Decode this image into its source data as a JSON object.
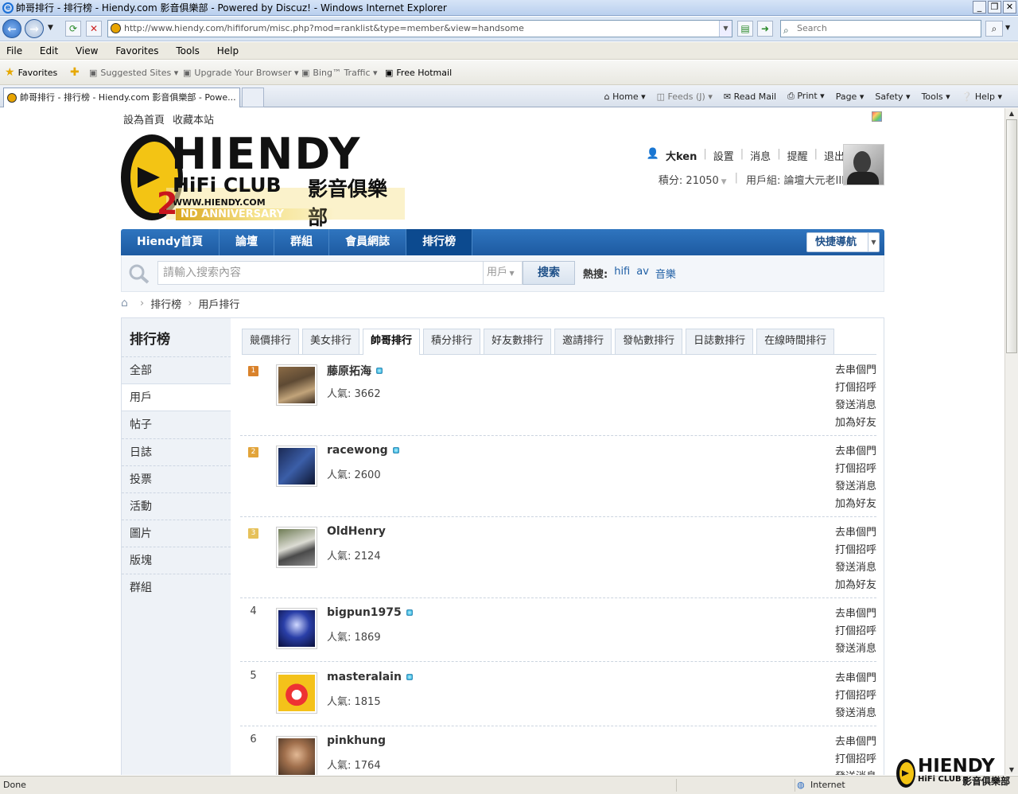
{
  "window": {
    "title": "帥哥排行 - 排行榜 - Hiendy.com 影音俱樂部 - Powered by Discuz! - Windows Internet Explorer"
  },
  "browser": {
    "url": "http://www.hiendy.com/hififorum/misc.php?mod=ranklist&type=member&view=handsome",
    "search_placeholder": "Search",
    "menu": [
      "File",
      "Edit",
      "View",
      "Favorites",
      "Tools",
      "Help"
    ],
    "favorites_label": "Favorites",
    "fav_items": [
      "Suggested Sites ▾",
      "Upgrade Your Browser ▾",
      "Bing™ Traffic ▾",
      "Free Hotmail"
    ],
    "tab_title": "帥哥排行 - 排行榜 - Hiendy.com 影音俱樂部 - Powe...",
    "commands": [
      "Home ▾",
      "Feeds (J) ▾",
      "Read Mail",
      "Print ▾",
      "Page ▾",
      "Safety ▾",
      "Tools ▾",
      "Help ▾"
    ],
    "status_left": "Done",
    "status_zone": "Internet"
  },
  "site": {
    "toplinks": [
      "設為首頁",
      "收藏本站"
    ],
    "logo": {
      "brand": "HIENDY",
      "sub1": "HiFi CLUB",
      "sub2": "影音俱樂部",
      "url": "WWW.HIENDY.COM",
      "anniv_num": "2",
      "anniv_text": "ND ANNIVERSARY"
    },
    "user": {
      "name": "大ken",
      "links": [
        "設置",
        "消息",
        "提醒",
        "退出"
      ],
      "points_label": "積分: 21050",
      "group_label": "用戶組: 論壇大元老III"
    },
    "nav": [
      "Hiendy首頁",
      "論壇",
      "群組",
      "會員網誌",
      "排行榜"
    ],
    "quicknav": "快捷導航",
    "search": {
      "placeholder": "請輸入搜索內容",
      "type": "用戶",
      "button": "搜索",
      "hot_label": "熱搜:",
      "hot": [
        "hifi",
        "av",
        "音樂"
      ]
    },
    "breadcrumb": [
      "排行榜",
      "用戶排行"
    ]
  },
  "sidebar": {
    "title": "排行榜",
    "items": [
      "全部",
      "用戶",
      "帖子",
      "日誌",
      "投票",
      "活動",
      "圖片",
      "版塊",
      "群組"
    ]
  },
  "ranktabs": [
    "競價排行",
    "美女排行",
    "帥哥排行",
    "積分排行",
    "好友數排行",
    "邀請排行",
    "發帖數排行",
    "日誌數排行",
    "在線時間排行"
  ],
  "ranklist": [
    {
      "rank": "1",
      "name": "藤原拓海",
      "pop": "人氣: 3662",
      "actions": [
        "去串個門",
        "打個招呼",
        "發送消息",
        "加為好友"
      ]
    },
    {
      "rank": "2",
      "name": "racewong",
      "pop": "人氣: 2600",
      "actions": [
        "去串個門",
        "打個招呼",
        "發送消息",
        "加為好友"
      ]
    },
    {
      "rank": "3",
      "name": "OldHenry",
      "pop": "人氣: 2124",
      "actions": [
        "去串個門",
        "打個招呼",
        "發送消息",
        "加為好友"
      ]
    },
    {
      "rank": "4",
      "name": "bigpun1975",
      "pop": "人氣: 1869",
      "actions": [
        "去串個門",
        "打個招呼",
        "發送消息"
      ]
    },
    {
      "rank": "5",
      "name": "masteralain",
      "pop": "人氣: 1815",
      "actions": [
        "去串個門",
        "打個招呼",
        "發送消息"
      ]
    },
    {
      "rank": "6",
      "name": "pinkhung",
      "pop": "人氣: 1764",
      "actions": [
        "去串個門",
        "打個招呼",
        "發送消息"
      ]
    }
  ],
  "colors": {
    "nav_blue": "#1d5aa1",
    "rank1": "#d9822b",
    "rank2": "#e2a43a",
    "rank3": "#e6c15a"
  }
}
